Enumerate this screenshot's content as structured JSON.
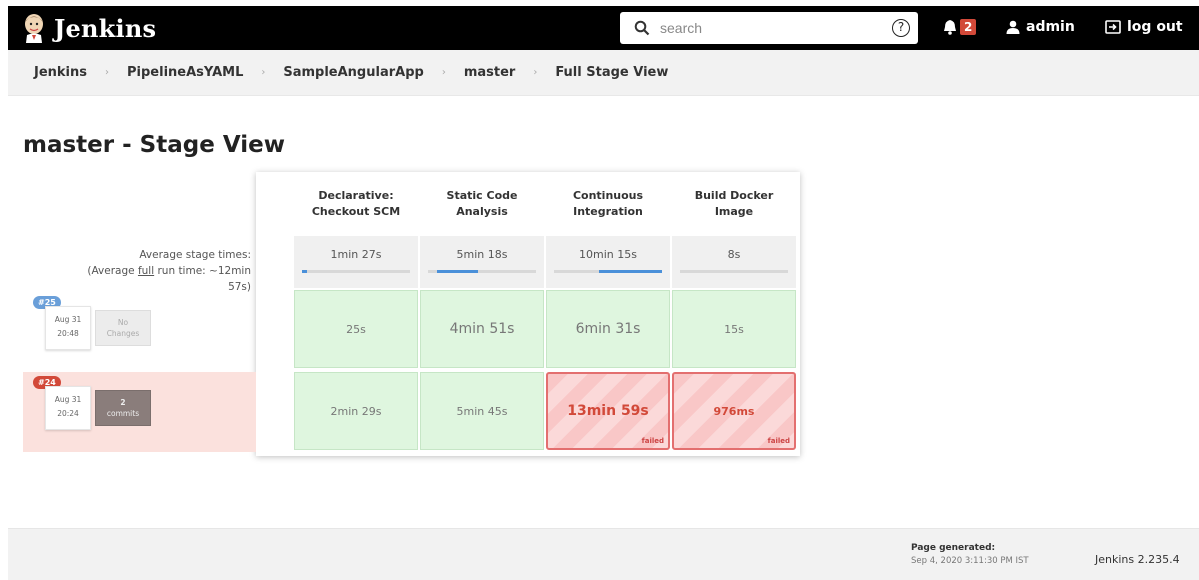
{
  "header": {
    "brand": "Jenkins",
    "search_placeholder": "search",
    "help": "?",
    "notification_count": "2",
    "user": "admin",
    "logout": "log out"
  },
  "breadcrumb": [
    "Jenkins",
    "PipelineAsYAML",
    "SampleAngularApp",
    "master",
    "Full Stage View"
  ],
  "page_title": "master - Stage View",
  "stage_view": {
    "avg_label_line1": "Average stage times:",
    "avg_label_line2_pre": "(Average ",
    "avg_label_line2_link": "full",
    "avg_label_line2_post": " run time: ~12min",
    "avg_label_line3": "57s)",
    "stages": [
      {
        "name_line1": "Declarative:",
        "name_line2": "Checkout SCM",
        "avg": "1min 27s",
        "bar_start": 0.0,
        "bar_fill": 0.05
      },
      {
        "name_line1": "Static Code",
        "name_line2": "Analysis",
        "avg": "5min 18s",
        "bar_start": 0.08,
        "bar_fill": 0.38
      },
      {
        "name_line1": "Continuous",
        "name_line2": "Integration",
        "avg": "10min 15s",
        "bar_start": 0.42,
        "bar_fill": 0.58
      },
      {
        "name_line1": "Build Docker",
        "name_line2": "Image",
        "avg": "8s",
        "bar_start": 0.0,
        "bar_fill": 0.0
      }
    ],
    "builds": [
      {
        "number": "#25",
        "date": "Aug 31",
        "time": "20:48",
        "changes_line1": "No",
        "changes_line2": "Changes",
        "cells": [
          "25s",
          "4min 51s",
          "6min 31s",
          "15s"
        ],
        "status": [
          "success",
          "success",
          "success",
          "success"
        ]
      },
      {
        "number": "#24",
        "date": "Aug 31",
        "time": "20:24",
        "changes_line1": "2",
        "changes_line2": "commits",
        "cells": [
          "2min 29s",
          "5min 45s",
          "13min 59s",
          "976ms"
        ],
        "status": [
          "success",
          "success",
          "failed",
          "failed"
        ],
        "failed_label": "failed"
      }
    ]
  },
  "footer": {
    "generated_label": "Page generated:",
    "generated_time": "Sep 4, 2020 3:11:30 PM IST",
    "version": "Jenkins 2.235.4"
  },
  "colors": {
    "header_bg": "#000000",
    "badge_red": "#d24939",
    "success_cell": "#dff6df",
    "failed_cell": "#f9c7c7",
    "bar_blue": "#4a90d9"
  }
}
